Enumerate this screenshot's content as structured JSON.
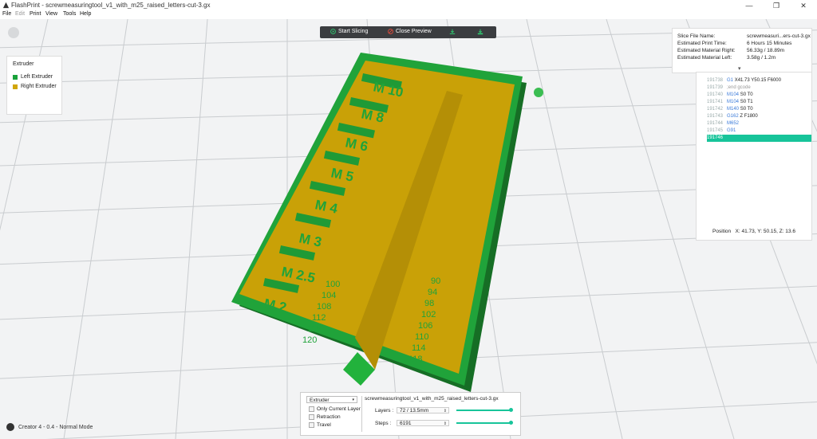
{
  "window": {
    "title": "FlashPrint - screwmeasuringtool_v1_with_m25_raised_letters-cut-3.gx",
    "controls": [
      "—",
      "❐",
      "✕"
    ]
  },
  "menu": {
    "items": [
      "File",
      "Edit",
      "Print",
      "View",
      "Tools",
      "Help"
    ]
  },
  "legend": {
    "title": "Extruder",
    "items": [
      {
        "label": "Left Extruder",
        "color": "#19a23a"
      },
      {
        "label": "Right Extruder",
        "color": "#d1a60a"
      }
    ]
  },
  "toolbar": {
    "start_slicing": "Start Slicing",
    "close_preview": "Close Preview"
  },
  "slice_info": {
    "rows": [
      {
        "key": "Slice File Name:",
        "value": "screwmeasuri...ers-cut-3.gx"
      },
      {
        "key": "Estimated Print Time:",
        "value": "6 Hours 15 Minutes"
      },
      {
        "key": "Estimated Material Right:",
        "value": "56.33g / 18.89m"
      },
      {
        "key": "Estimated Material Left:",
        "value": "3.58g / 1.2m"
      }
    ]
  },
  "gcode": {
    "lines": [
      {
        "num": "191738",
        "cmd": "G1",
        "args": "X41.73 Y50.15 F6000"
      },
      {
        "num": "191739",
        "cmd": "",
        "args": ";end gcode"
      },
      {
        "num": "191740",
        "cmd": "M104",
        "args": "S0 T0"
      },
      {
        "num": "191741",
        "cmd": "M104",
        "args": "S0 T1"
      },
      {
        "num": "191742",
        "cmd": "M140",
        "args": "S0 T0"
      },
      {
        "num": "191743",
        "cmd": "G162",
        "args": "Z F1800"
      },
      {
        "num": "191744",
        "cmd": "M652",
        "args": ""
      },
      {
        "num": "191745",
        "cmd": "G91",
        "args": ""
      },
      {
        "num": "191746",
        "cmd": "",
        "args": ""
      }
    ],
    "position_label": "Position",
    "position_value": "X: 41.73, Y: 50.15, Z: 13.6"
  },
  "bottom": {
    "dropdown": "Extruder",
    "checks": [
      "Only Current Layer",
      "Retraction",
      "Travel"
    ],
    "filename": "screwmeasuringtool_v1_with_m25_raised_letters-cut-3.gx",
    "layers_label": "Layers :",
    "layers_value": "72 / 13.5mm",
    "steps_label": "Steps :",
    "steps_value": "6191"
  },
  "footer": {
    "printer": "Creator 4 - 0.4 - Normal Mode"
  },
  "model_labels": {
    "sizes": [
      "M 10",
      "M 8",
      "M 6",
      "M 5",
      "M 4",
      "M 3",
      "M 2.5",
      "M 2"
    ],
    "left_numbers": [
      "100",
      "104",
      "108",
      "112",
      "116",
      "120"
    ],
    "right_numbers": [
      "90",
      "94",
      "98",
      "102",
      "106",
      "110",
      "114",
      "118"
    ]
  }
}
